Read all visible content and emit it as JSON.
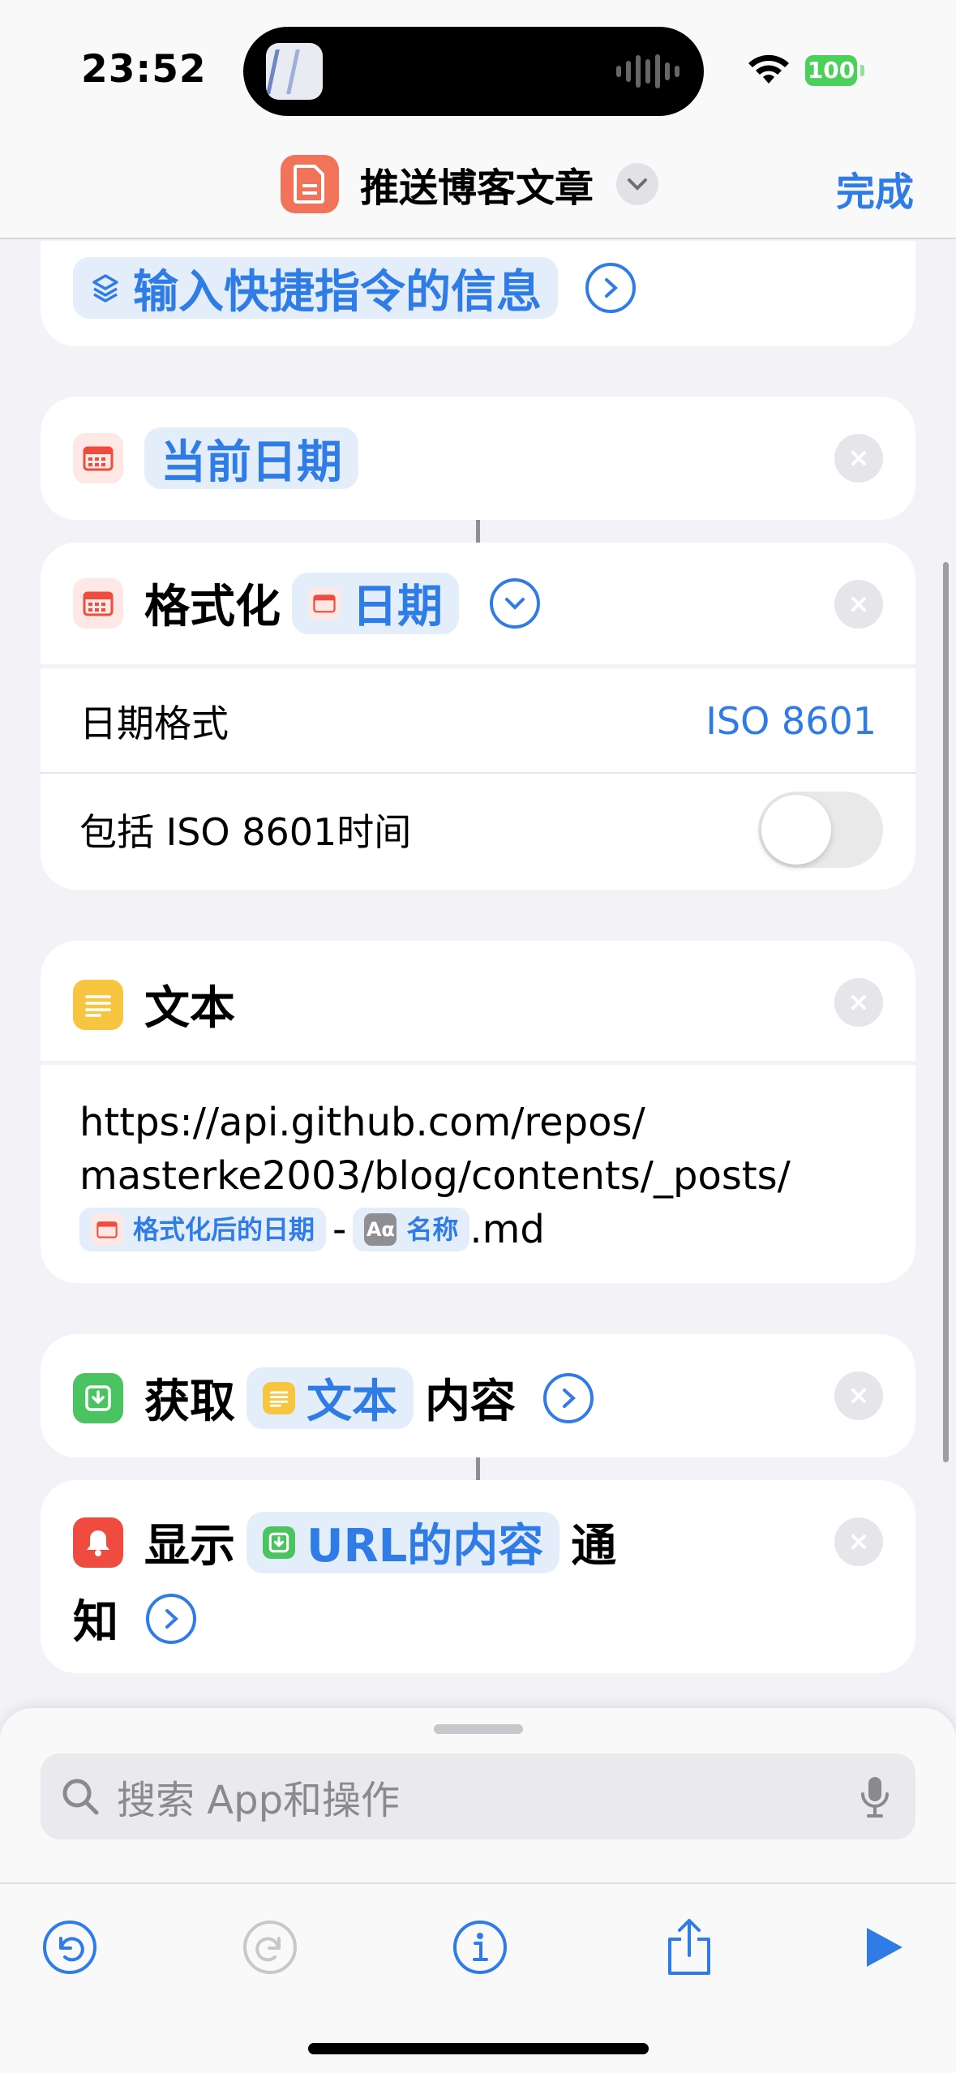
{
  "status_bar": {
    "time": "23:52",
    "battery": "100"
  },
  "nav": {
    "title": "推送博客文章",
    "done_label": "完成"
  },
  "actions": {
    "input_card": {
      "token": "输入快捷指令的信息"
    },
    "current_date": {
      "token": "当前日期"
    },
    "format_date": {
      "verb": "格式化",
      "token": "日期",
      "date_format_label": "日期格式",
      "date_format_value": "ISO 8601",
      "include_time_label": "包括 ISO 8601时间",
      "include_time_on": false
    },
    "text": {
      "title": "文本",
      "line1": "https://api.github.com/repos/",
      "line2": "masterke2003/blog/contents/_posts/",
      "var1": "格式化后的日期",
      "dash": "-",
      "var2": "名称",
      "suffix": ".md",
      "aa_glyph": "Aα"
    },
    "get_contents": {
      "verb": "获取",
      "token": "文本",
      "noun": "内容"
    },
    "show_notification": {
      "verb": "显示",
      "token": "URL的内容",
      "noun1": "通",
      "noun2": "知"
    }
  },
  "search": {
    "placeholder": "搜索 App和操作"
  },
  "colors": {
    "accent": "#2f7ce6",
    "battery": "#4bd15a",
    "app_icon": "#f0735a"
  },
  "icons": [
    "calendar-icon",
    "text-icon",
    "download-icon",
    "bell-icon",
    "search-icon",
    "mic-icon",
    "undo-icon",
    "redo-icon",
    "info-icon",
    "share-icon",
    "play-icon"
  ]
}
